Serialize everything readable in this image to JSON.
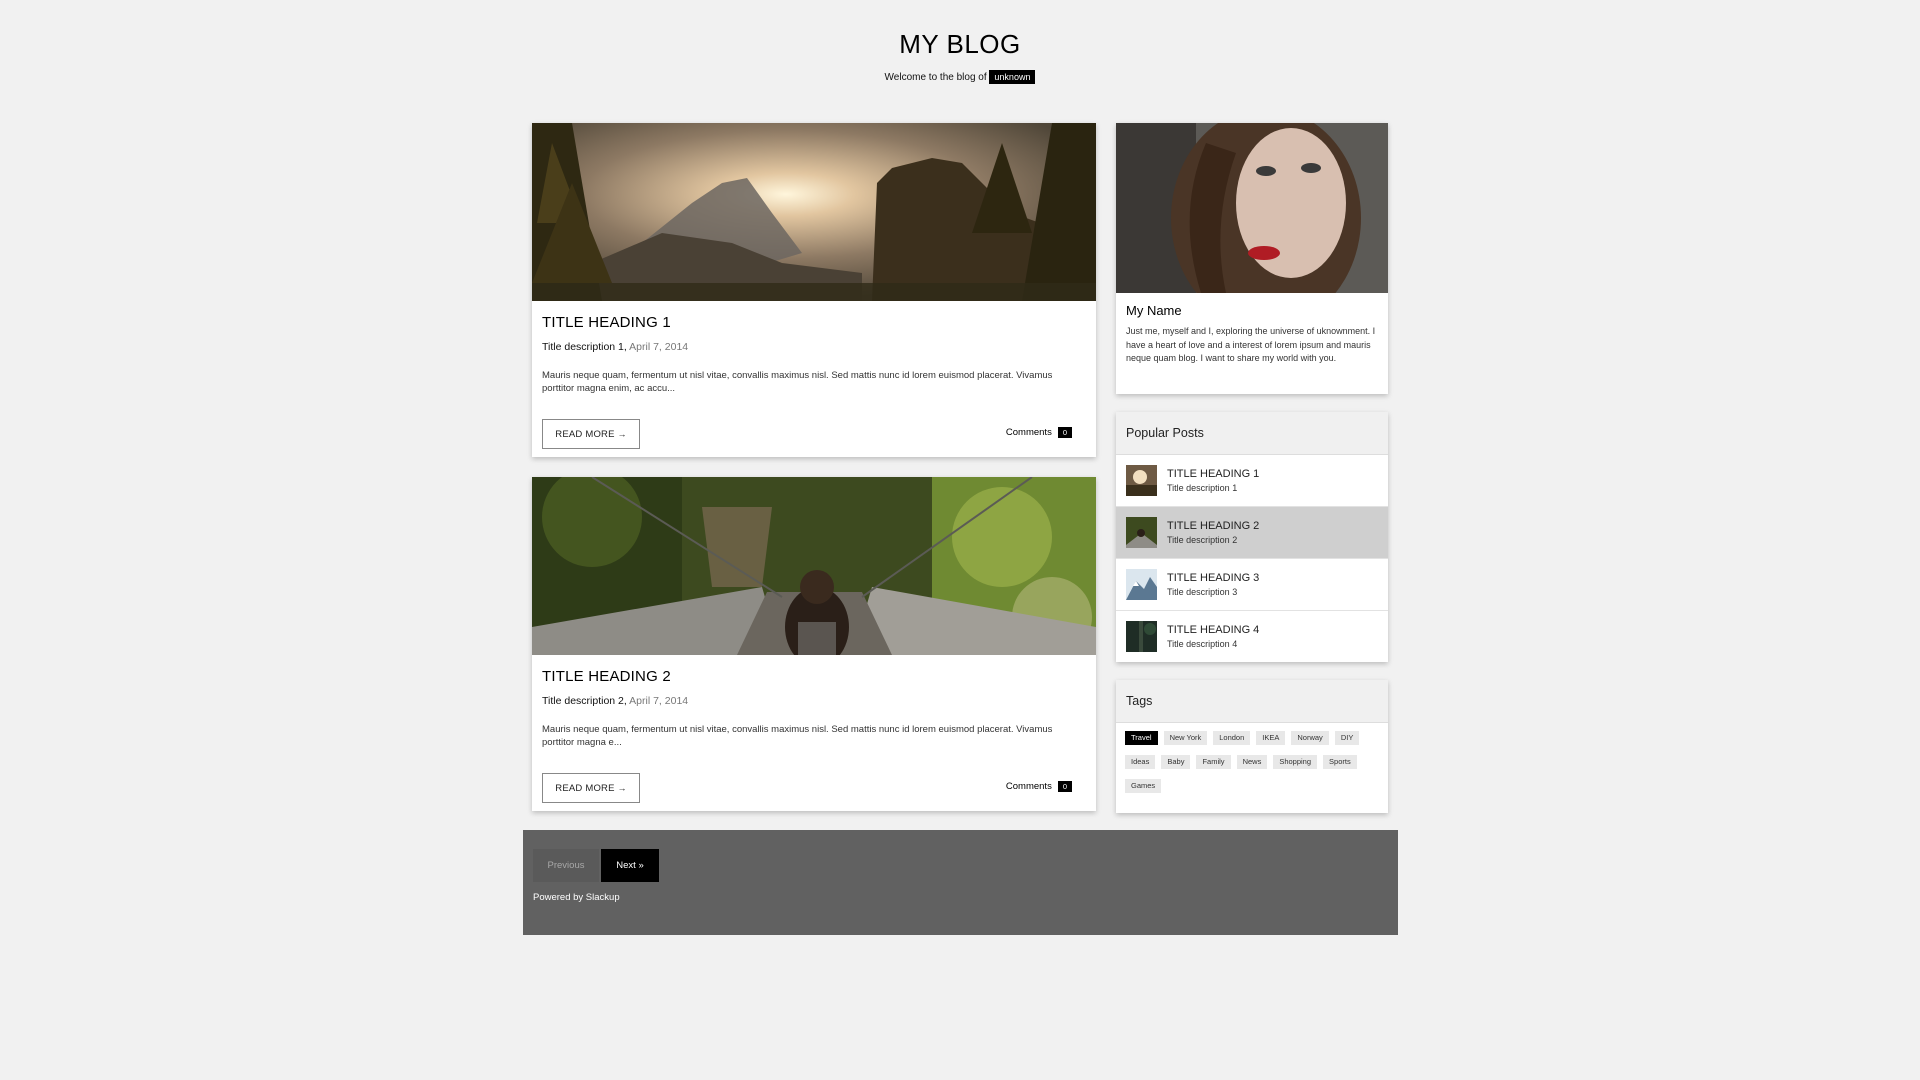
{
  "header": {
    "title": "MY BLOG",
    "welcome_text": "Welcome to the blog of",
    "username": "unknown"
  },
  "posts": [
    {
      "title": "TITLE HEADING 1",
      "description": "Title description 1,",
      "date": "April 7, 2014",
      "excerpt": "Mauris neque quam, fermentum ut nisl vitae, convallis maximus nisl. Sed mattis nunc id lorem euismod placerat. Vivamus porttitor magna enim, ac accu...",
      "read_more": "READ MORE",
      "comments_label": "Comments",
      "comments_count": "0",
      "image": "mountain-sunset-image"
    },
    {
      "title": "TITLE HEADING 2",
      "description": "Title description 2,",
      "date": "April 7, 2014",
      "excerpt": "Mauris neque quam, fermentum ut nisl vitae, convallis maximus nisl. Sed mattis nunc id lorem euismod placerat. Vivamus porttitor magna e...",
      "read_more": "READ MORE",
      "comments_label": "Comments",
      "comments_count": "0",
      "image": "forest-bridge-image"
    }
  ],
  "profile": {
    "name": "My Name",
    "bio": "Just me, myself and I, exploring the universe of uknownment. I have a heart of love and a interest of lorem ipsum and mauris neque quam blog. I want to share my world with you."
  },
  "popular": {
    "heading": "Popular Posts",
    "items": [
      {
        "title": "TITLE HEADING 1",
        "desc": "Title description 1"
      },
      {
        "title": "TITLE HEADING 2",
        "desc": "Title description 2"
      },
      {
        "title": "TITLE HEADING 3",
        "desc": "Title description 3"
      },
      {
        "title": "TITLE HEADING 4",
        "desc": "Title description 4"
      }
    ]
  },
  "tags": {
    "heading": "Tags",
    "items": [
      "Travel",
      "New York",
      "London",
      "IKEA",
      "Norway",
      "DIY",
      "Ideas",
      "Baby",
      "Family",
      "News",
      "Shopping",
      "Sports",
      "Games"
    ]
  },
  "pagination": {
    "previous": "Previous",
    "next": "Next »"
  },
  "footer": {
    "powered_by": "Powered by Slackup"
  },
  "colors": {
    "background": "#f1f1f1",
    "accent": "#000000",
    "footer": "#616161",
    "active_item": "#cfcfcf"
  }
}
